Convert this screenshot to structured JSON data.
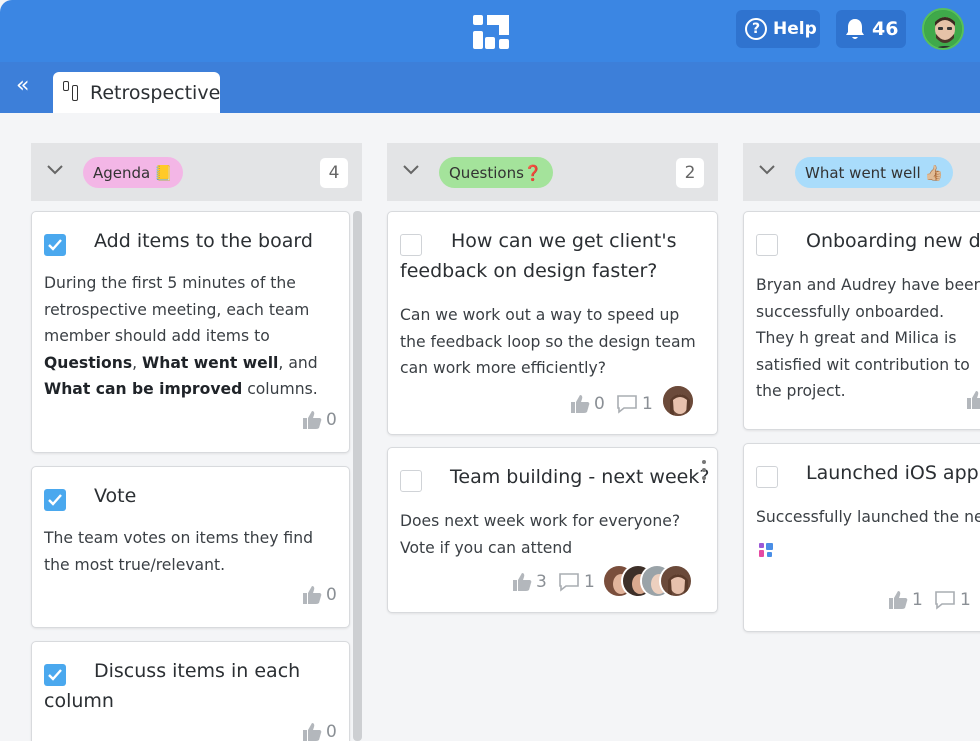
{
  "header": {
    "help_label": "Help",
    "notifications_count": "46"
  },
  "tabs": [
    {
      "label": "Retrospective"
    }
  ],
  "columns": [
    {
      "label": "Agenda",
      "emoji": "📒",
      "count": "4",
      "pill_color": "#f3b6e6",
      "cards": [
        {
          "title": "Add items to the board",
          "body_parts": [
            {
              "text": "During the first 5 minutes of the retrospective meeting, each team member should add items to ",
              "bold": false
            },
            {
              "text": "Questions",
              "bold": true
            },
            {
              "text": ", ",
              "bold": false
            },
            {
              "text": "What went well",
              "bold": true
            },
            {
              "text": ", and ",
              "bold": false
            },
            {
              "text": "What can be improved",
              "bold": true
            },
            {
              "text": " columns.",
              "bold": false
            }
          ],
          "likes": "0"
        },
        {
          "title": "Vote",
          "body": "The team votes on items they find the most true/relevant.",
          "likes": "0"
        },
        {
          "title": "Discuss items in each column",
          "likes": "0"
        }
      ]
    },
    {
      "label": "Questions",
      "emoji": "❓",
      "count": "2",
      "pill_color": "#a4e39b",
      "cards": [
        {
          "title": "How can we get client's feedback on design faster?",
          "body": "Can we work out a way to speed up the feedback loop so the design team can work more efficiently?",
          "likes": "0",
          "comments": "1"
        },
        {
          "title": "Team building - next week?",
          "body": "Does next week work for everyone? Vote if you can attend",
          "likes": "3",
          "comments": "1"
        }
      ]
    },
    {
      "label": "What went well",
      "emoji": "👍🏼",
      "pill_color": "#a9dcfb",
      "cards": [
        {
          "title": "Onboarding new de",
          "body": "Bryan and Audrey have been successfully onboarded. They h great and Milica is satisfied wit contribution to the project."
        },
        {
          "title": "Launched iOS app",
          "body": "Successfully launched the new",
          "likes": "1",
          "comments": "1"
        }
      ]
    }
  ],
  "colors": {
    "header_bg": "#3b86e3",
    "subbar_bg": "#3d7fd9",
    "checkbox_on": "#4aa8ee"
  }
}
